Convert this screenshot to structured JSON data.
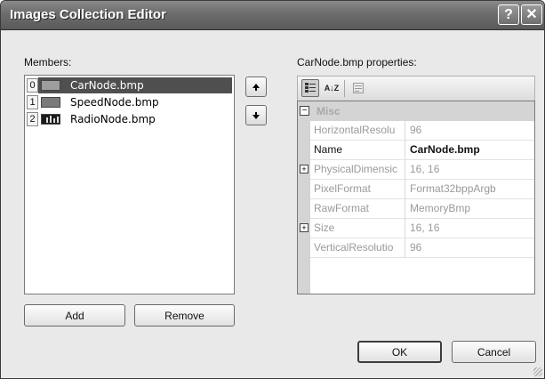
{
  "window": {
    "title": "Images Collection Editor",
    "help_label": "?",
    "close_label": "✕"
  },
  "members": {
    "label": "Members:",
    "items": [
      {
        "index": "0",
        "name": "CarNode.bmp",
        "selected": true
      },
      {
        "index": "1",
        "name": "SpeedNode.bmp",
        "selected": false
      },
      {
        "index": "2",
        "name": "RadioNode.bmp",
        "selected": false
      }
    ],
    "move_up_icon": "up-arrow-icon",
    "move_down_icon": "down-arrow-icon"
  },
  "buttons": {
    "add": "Add",
    "remove": "Remove",
    "ok": "OK",
    "cancel": "Cancel"
  },
  "properties": {
    "label": "CarNode.bmp properties:",
    "toolbar": {
      "categorized_icon": "categorized-icon",
      "alphabetical_label": "A↓Z",
      "property_pages_icon": "property-pages-icon"
    },
    "category": {
      "expander": "⊟",
      "name": "Misc"
    },
    "rows": [
      {
        "name": "HorizontalResolu",
        "value": "96",
        "expander": ""
      },
      {
        "name": "Name",
        "value": "CarNode.bmp",
        "expander": ""
      },
      {
        "name": "PhysicalDimensic",
        "value": "16, 16",
        "expander": "+"
      },
      {
        "name": "PixelFormat",
        "value": "Format32bppArgb",
        "expander": ""
      },
      {
        "name": "RawFormat",
        "value": "MemoryBmp",
        "expander": ""
      },
      {
        "name": "Size",
        "value": "16, 16",
        "expander": "+"
      },
      {
        "name": "VerticalResolutio",
        "value": "96",
        "expander": ""
      }
    ]
  }
}
